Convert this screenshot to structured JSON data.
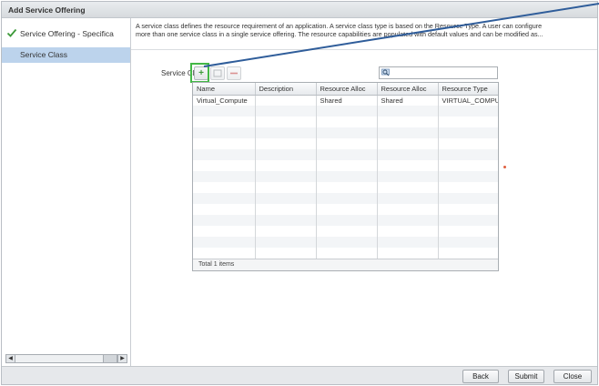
{
  "dialog": {
    "title": "Add Service Offering"
  },
  "wizard": {
    "steps": [
      {
        "label": "Service Offering - Specifica",
        "completed": true
      },
      {
        "label": "Service Class",
        "completed": false,
        "selected": true
      }
    ]
  },
  "main": {
    "description_line1": "A service class defines the resource requirement of an application. A service class type is based on the Resource Type. A user can configure",
    "description_line2": "more than one service class in a single service offering. The resource capabilities are populated with default values and can be modified as...",
    "service_class_label": "Service Class",
    "toolbar": {
      "add_icon": "plus-icon",
      "edit_icon": "edit-icon",
      "delete_icon": "delete-icon"
    },
    "search": {
      "placeholder": "",
      "icon": "search-icon"
    },
    "table": {
      "columns": [
        "Name",
        "Description",
        "Resource Alloc",
        "Resource Alloc",
        "Resource Type"
      ],
      "rows": [
        [
          "Virtual_Compute",
          "",
          "Shared",
          "Shared",
          "VIRTUAL_COMPU"
        ]
      ],
      "footer": "Total 1 items"
    }
  },
  "buttons": {
    "back": "Back",
    "submit": "Submit",
    "close": "Close"
  },
  "colors": {
    "selected_step": "#bcd3ec",
    "checkmark": "#3d9a3a",
    "highlight_box": "#44b847",
    "callout_line": "#2f5d9a"
  }
}
